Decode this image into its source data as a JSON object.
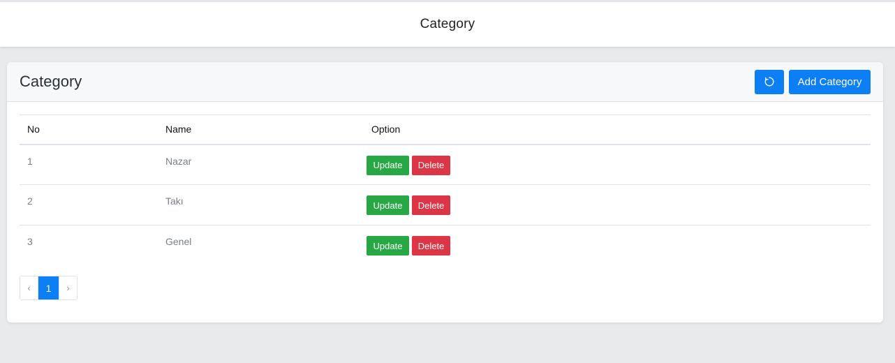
{
  "topbar": {
    "title": "Category"
  },
  "card": {
    "title": "Category",
    "add_label": "Add Category",
    "refresh_icon": "refresh-icon"
  },
  "table": {
    "headers": [
      "No",
      "Name",
      "Option"
    ],
    "rows": [
      {
        "no": "1",
        "name": "Nazar",
        "update_label": "Update",
        "delete_label": "Delete"
      },
      {
        "no": "2",
        "name": "Takı",
        "update_label": "Update",
        "delete_label": "Delete"
      },
      {
        "no": "3",
        "name": "Genel",
        "update_label": "Update",
        "delete_label": "Delete"
      }
    ]
  },
  "pagination": {
    "prev": "‹",
    "current": "1",
    "next": "›"
  },
  "colors": {
    "primary": "#0d7ff5",
    "success": "#28a745",
    "danger": "#dc3545"
  }
}
